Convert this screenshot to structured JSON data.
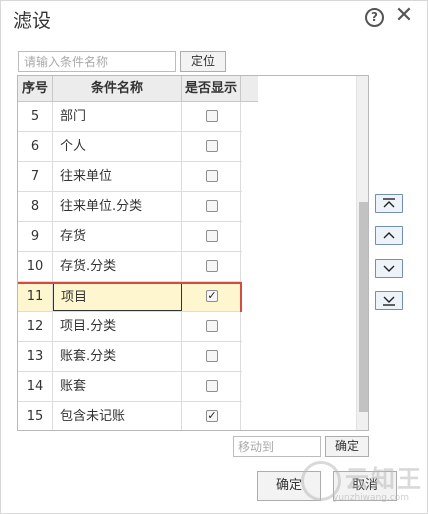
{
  "dialog": {
    "title": "滤设",
    "help_symbol": "?",
    "close_symbol": "✕"
  },
  "search": {
    "placeholder": "请输入条件名称",
    "button_label": "定位"
  },
  "table": {
    "headers": {
      "seq": "序号",
      "name": "条件名称",
      "show": "是否显示"
    },
    "rows": [
      {
        "seq": "5",
        "name": "部门",
        "checked": false
      },
      {
        "seq": "6",
        "name": "个人",
        "checked": false
      },
      {
        "seq": "7",
        "name": "往来单位",
        "checked": false
      },
      {
        "seq": "8",
        "name": "往来单位.分类",
        "checked": false
      },
      {
        "seq": "9",
        "name": "存货",
        "checked": false
      },
      {
        "seq": "10",
        "name": "存货.分类",
        "checked": false
      },
      {
        "seq": "11",
        "name": "项目",
        "checked": true,
        "selected": true
      },
      {
        "seq": "12",
        "name": "项目.分类",
        "checked": false
      },
      {
        "seq": "13",
        "name": "账套.分类",
        "checked": false
      },
      {
        "seq": "14",
        "name": "账套",
        "checked": false
      },
      {
        "seq": "15",
        "name": "包含未记账",
        "checked": true
      }
    ]
  },
  "move_buttons": {
    "top_icon": "move-to-top-icon",
    "up_icon": "move-up-icon",
    "down_icon": "move-down-icon",
    "bottom_icon": "move-to-bottom-icon"
  },
  "move_to": {
    "placeholder": "移动到",
    "button_label": "确定"
  },
  "footer": {
    "ok_label": "确定",
    "cancel_label": "取消"
  },
  "watermark": {
    "text": "云知王",
    "sub": "yunzhiwang.com"
  },
  "colors": {
    "selected_row_bg": "#fdf6cf",
    "selected_row_border": "#d44b41",
    "header_bg": "#ececec",
    "side_button_border": "#6f8fb3"
  }
}
